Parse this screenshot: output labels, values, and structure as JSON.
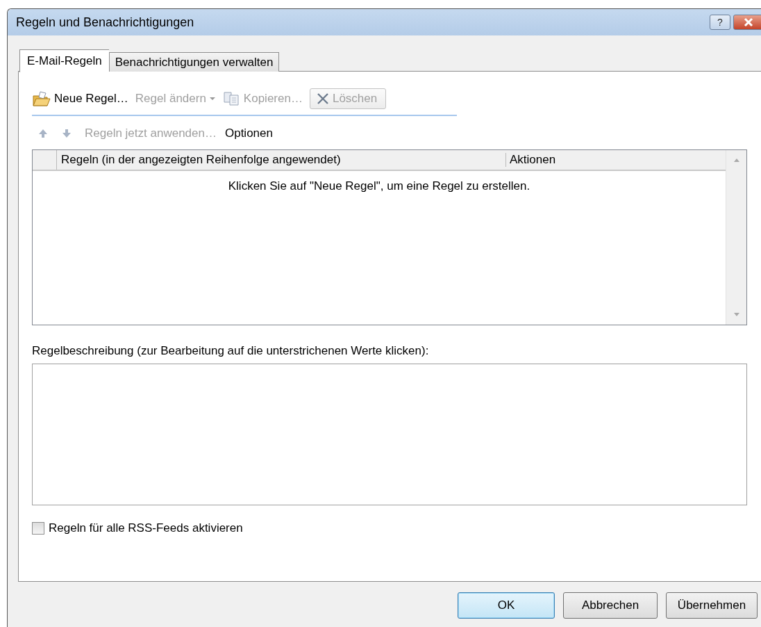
{
  "window": {
    "title": "Regeln und Benachrichtigungen",
    "help_label": "?"
  },
  "tabs": [
    {
      "label": "E-Mail-Regeln",
      "selected": true
    },
    {
      "label": "Benachrichtigungen verwalten",
      "selected": false
    }
  ],
  "toolbar": [
    {
      "kind": "new",
      "label": "Neue Regel…",
      "disabled": false
    },
    {
      "kind": "dropdown",
      "label": "Regel ändern",
      "disabled": true
    },
    {
      "kind": "copy",
      "label": "Kopieren…",
      "disabled": true
    },
    {
      "kind": "delete",
      "label": "Löschen",
      "disabled": true
    }
  ],
  "toolbar2": [
    {
      "kind": "up",
      "disabled": true
    },
    {
      "kind": "down",
      "disabled": true
    },
    {
      "kind": "text",
      "label": "Regeln jetzt anwenden…",
      "disabled": true
    },
    {
      "kind": "text",
      "label": "Optionen",
      "disabled": false
    }
  ],
  "table": {
    "columns": [
      "Regeln (in der angezeigten Reihenfolge angewendet)",
      "Aktionen"
    ],
    "empty_message": "Klicken Sie auf \"Neue Regel\", um eine Regel zu erstellen."
  },
  "description": {
    "label": "Regelbeschreibung (zur Bearbeitung auf die unterstrichenen Werte klicken):"
  },
  "rss_checkbox": {
    "label": "Regeln für alle RSS-Feeds aktivieren",
    "checked": false
  },
  "buttons": [
    {
      "label": "OK",
      "default": true
    },
    {
      "label": "Abbrechen",
      "default": false
    },
    {
      "label": "Übernehmen",
      "default": false
    }
  ]
}
